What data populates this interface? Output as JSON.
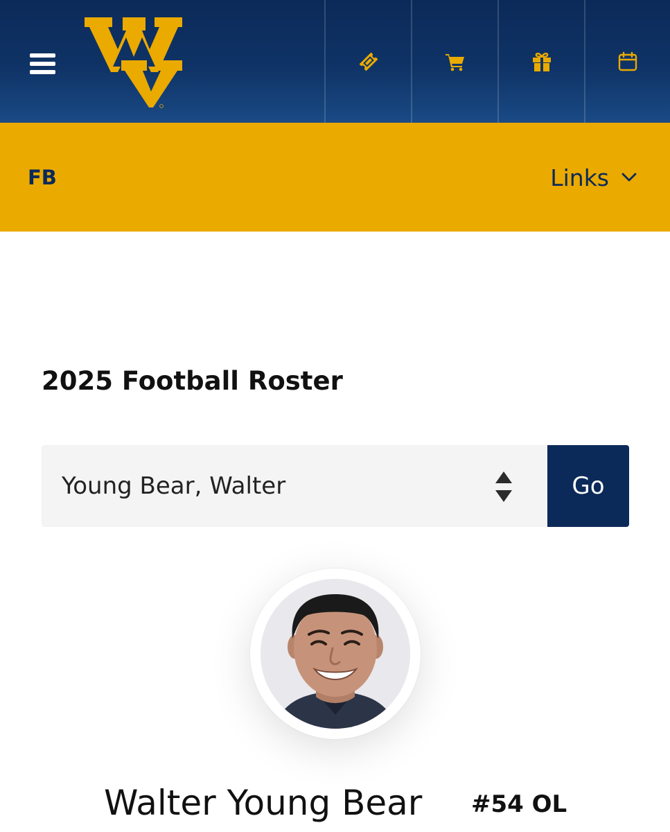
{
  "header": {
    "menu_icon": "hamburger-menu-icon",
    "logo": "flying-wv-logo",
    "icons": [
      "ticket-icon",
      "shopping-cart-icon",
      "gift-icon",
      "calendar-icon"
    ],
    "colors": {
      "navy": "#0b2a59",
      "gold": "#eaaa00"
    }
  },
  "sport_nav": {
    "sport": "FB",
    "links_label": "Links",
    "links_icon": "chevron-down-icon"
  },
  "roster": {
    "title": "2025 Football Roster",
    "selected_player": "Young Bear, Walter",
    "go_label": "Go"
  },
  "player": {
    "name": "Walter Young Bear",
    "number_position": "#54 OL"
  }
}
